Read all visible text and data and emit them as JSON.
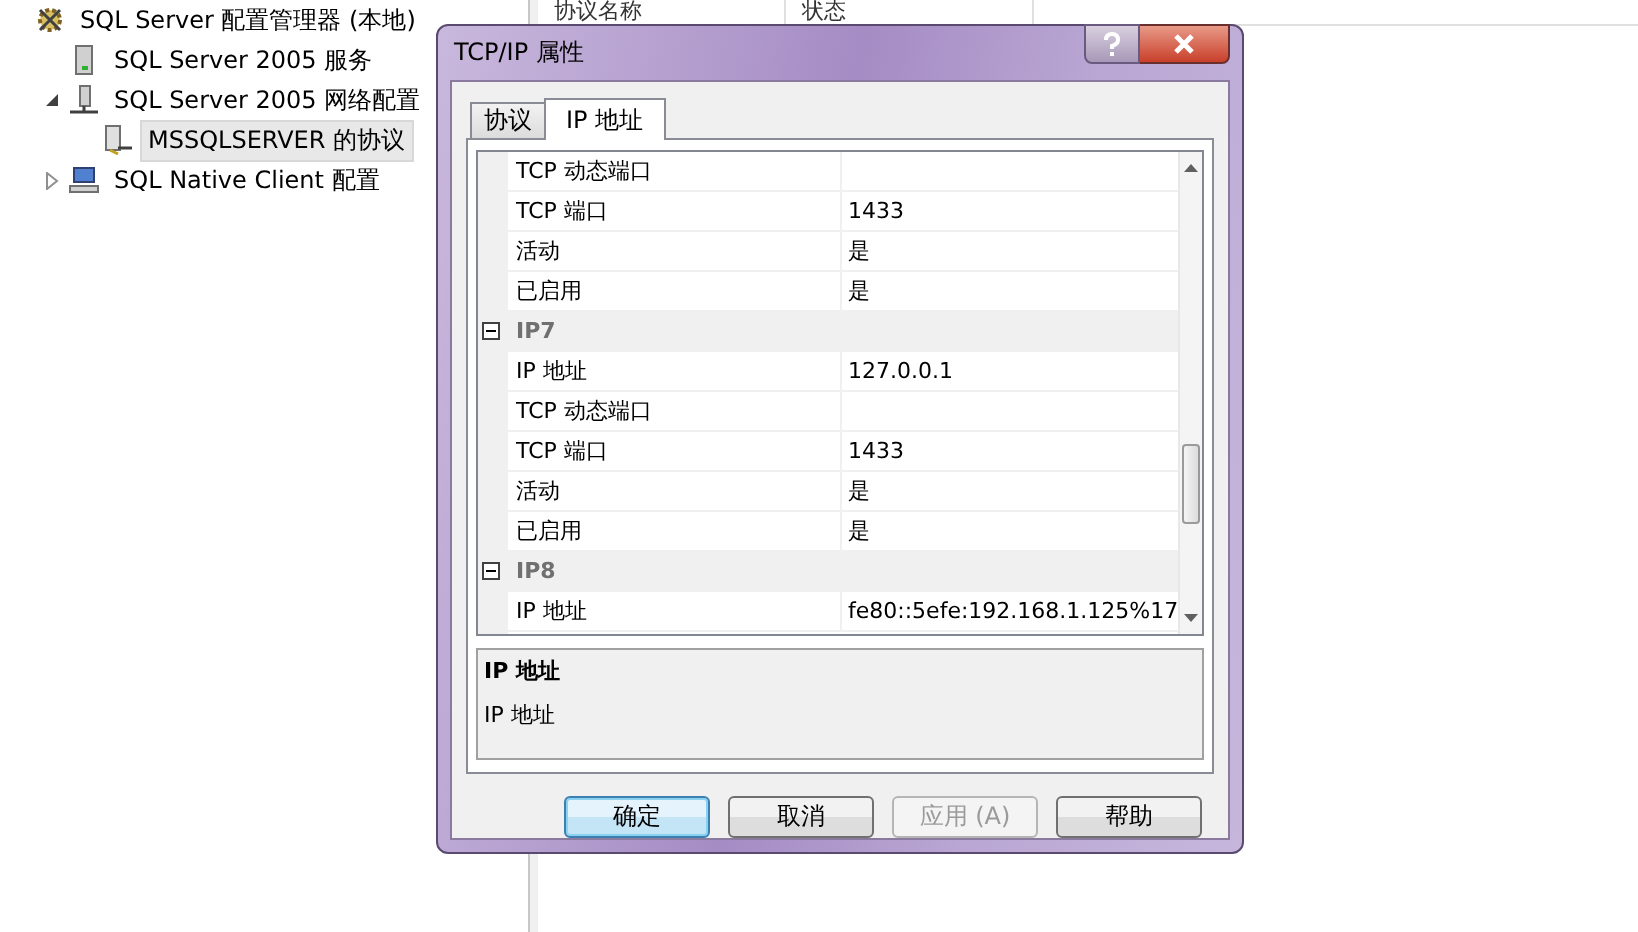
{
  "tree": [
    {
      "label": "SQL Server 配置管理器 (本地)",
      "kind": "root",
      "selected": false,
      "children": [
        {
          "label": "SQL Server 2005 服务",
          "kind": "service",
          "selected": false
        },
        {
          "label": "SQL Server 2005 网络配置",
          "kind": "network",
          "selected": false,
          "expanded": true,
          "children": [
            {
              "label": "MSSQLSERVER 的协议",
              "kind": "protocol",
              "selected": true
            }
          ]
        },
        {
          "label": "SQL Native Client 配置",
          "kind": "client",
          "selected": false,
          "expanded": false
        }
      ]
    }
  ],
  "list": {
    "columns": [
      "协议名称",
      "状态"
    ]
  },
  "dialog": {
    "title": "TCP/IP 属性",
    "tabs": [
      {
        "label": "协议",
        "selected": false
      },
      {
        "label": "IP 地址",
        "selected": true
      }
    ],
    "rows": [
      {
        "kind": "property",
        "name": "TCP 动态端口",
        "value": ""
      },
      {
        "kind": "property",
        "name": "TCP 端口",
        "value": "1433"
      },
      {
        "kind": "property",
        "name": "活动",
        "value": "是"
      },
      {
        "kind": "property",
        "name": "已启用",
        "value": "是"
      },
      {
        "kind": "group",
        "name": "IP7",
        "expanded": true
      },
      {
        "kind": "property",
        "name": "IP 地址",
        "value": "127.0.0.1"
      },
      {
        "kind": "property",
        "name": "TCP 动态端口",
        "value": ""
      },
      {
        "kind": "property",
        "name": "TCP 端口",
        "value": "1433"
      },
      {
        "kind": "property",
        "name": "活动",
        "value": "是"
      },
      {
        "kind": "property",
        "name": "已启用",
        "value": "是"
      },
      {
        "kind": "group",
        "name": "IP8",
        "expanded": true
      },
      {
        "kind": "property",
        "name": "IP 地址",
        "value": "fe80::5efe:192.168.1.125%17"
      }
    ],
    "description": {
      "title": "IP 地址",
      "text": "IP 地址"
    },
    "buttons": [
      {
        "label": "确定",
        "default": true,
        "disabled": false
      },
      {
        "label": "取消",
        "default": false,
        "disabled": false
      },
      {
        "label": "应用 (A)",
        "default": false,
        "disabled": true
      },
      {
        "label": "帮助",
        "default": false,
        "disabled": false
      }
    ]
  }
}
